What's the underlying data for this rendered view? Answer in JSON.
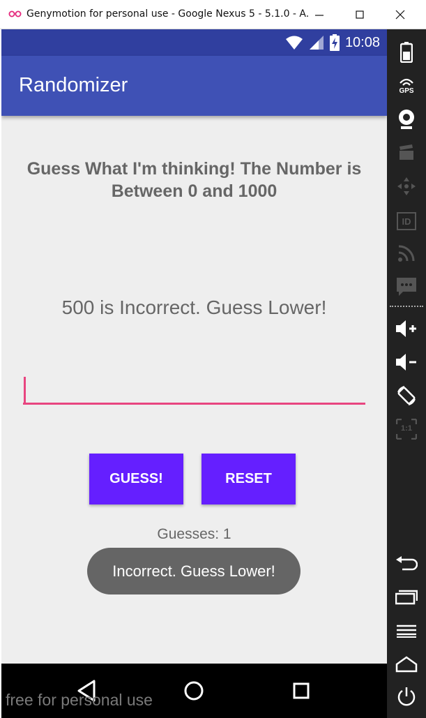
{
  "window": {
    "title": "Genymotion for personal use - Google Nexus 5 - 5.1.0 - A...",
    "controls": [
      "minimize-icon",
      "maximize-icon",
      "close-icon"
    ]
  },
  "status_bar": {
    "time": "10:08",
    "icons": [
      "wifi-icon",
      "cell-signal-icon",
      "battery-charging-icon"
    ]
  },
  "app_bar": {
    "title": "Randomizer"
  },
  "main": {
    "heading": "Guess What I'm thinking! The Number is Between 0 and 1000",
    "result_text": "500 is Incorrect. Guess Lower!",
    "input": {
      "value": "",
      "placeholder": ""
    },
    "guess_button": "GUESS!",
    "reset_button": "RESET",
    "guess_count_text": "Guesses: 1"
  },
  "toast": {
    "text": "Incorrect. Guess Lower!"
  },
  "nav_bar": {
    "buttons": [
      "back-icon",
      "home-icon",
      "recents-icon"
    ]
  },
  "watermark": "free for personal use",
  "side_panel": {
    "gps_label": "GPS",
    "id_label": "ID",
    "scale_label": "1:1",
    "icons": [
      "battery-icon",
      "gps-icon",
      "webcam-icon",
      "video-capture-icon",
      "dpad-icon",
      "id-icon",
      "rss-icon",
      "sms-icon",
      "volume-up-icon",
      "volume-down-icon",
      "rotate-icon",
      "scale-icon",
      "back-icon",
      "recent-apps-icon",
      "menu-icon",
      "home-icon",
      "power-icon"
    ]
  },
  "colors": {
    "status_bar": "#303f9f",
    "app_bar": "#3f51b5",
    "button": "#651fff",
    "accent": "#e84580",
    "background": "#eeeeee",
    "toast": "#656565"
  }
}
